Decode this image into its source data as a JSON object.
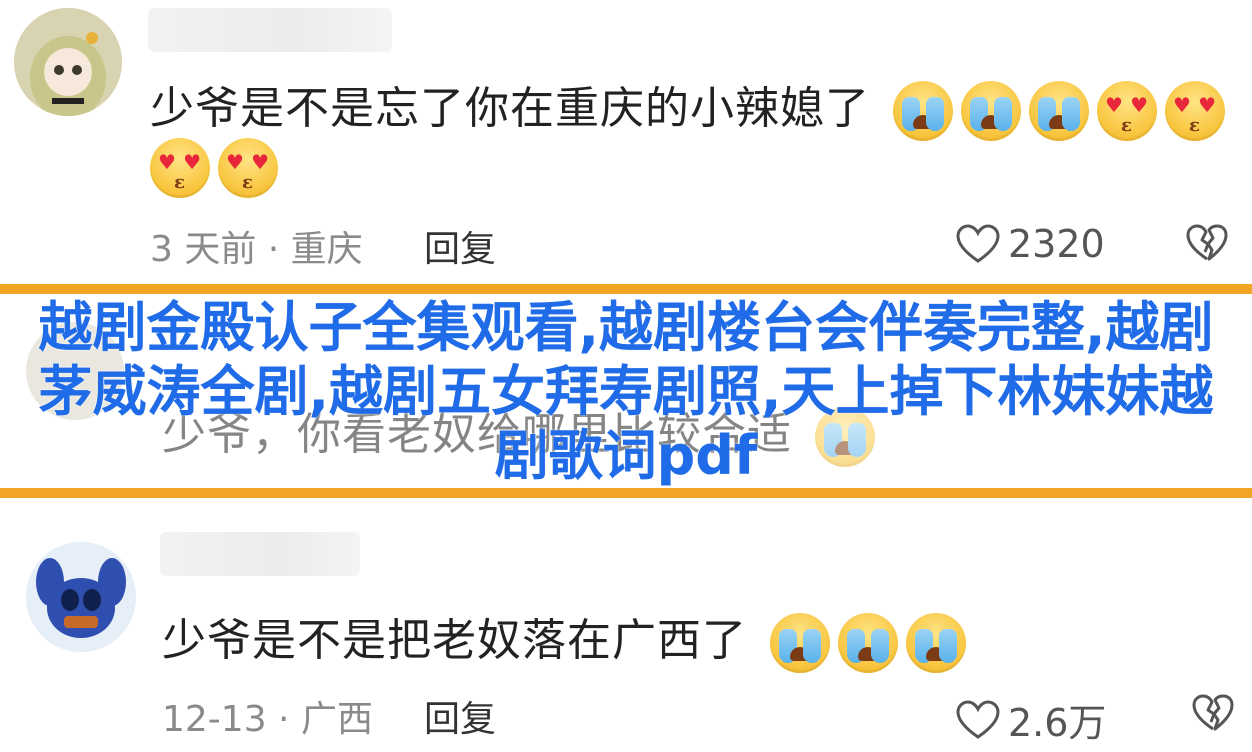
{
  "comments": [
    {
      "text": "少爷是不是忘了你在重庆的小辣媳了",
      "emojis": [
        "cry",
        "cry",
        "cry",
        "love",
        "love",
        "love",
        "love"
      ],
      "meta": "3 天前 · 重庆",
      "reply_label": "回复",
      "likes": "2320"
    },
    {
      "text": "少爷，你看老奴给哪里比较合适",
      "emojis": [
        "cry"
      ]
    },
    {
      "text": "少爷是不是把老奴落在广西了",
      "emojis": [
        "cry",
        "cry",
        "cry"
      ],
      "meta": "12-13 · 广西",
      "reply_label": "回复",
      "likes": "2.6万"
    }
  ],
  "overlay": {
    "title": "越剧金殿认子全集观看,越剧楼台会伴奏完整,越剧茅威涛全剧,越剧五女拜寿剧照,天上掉下林妹妹越剧歌词pdf",
    "color": "#1f6be8",
    "band_color": "#f0a624"
  }
}
